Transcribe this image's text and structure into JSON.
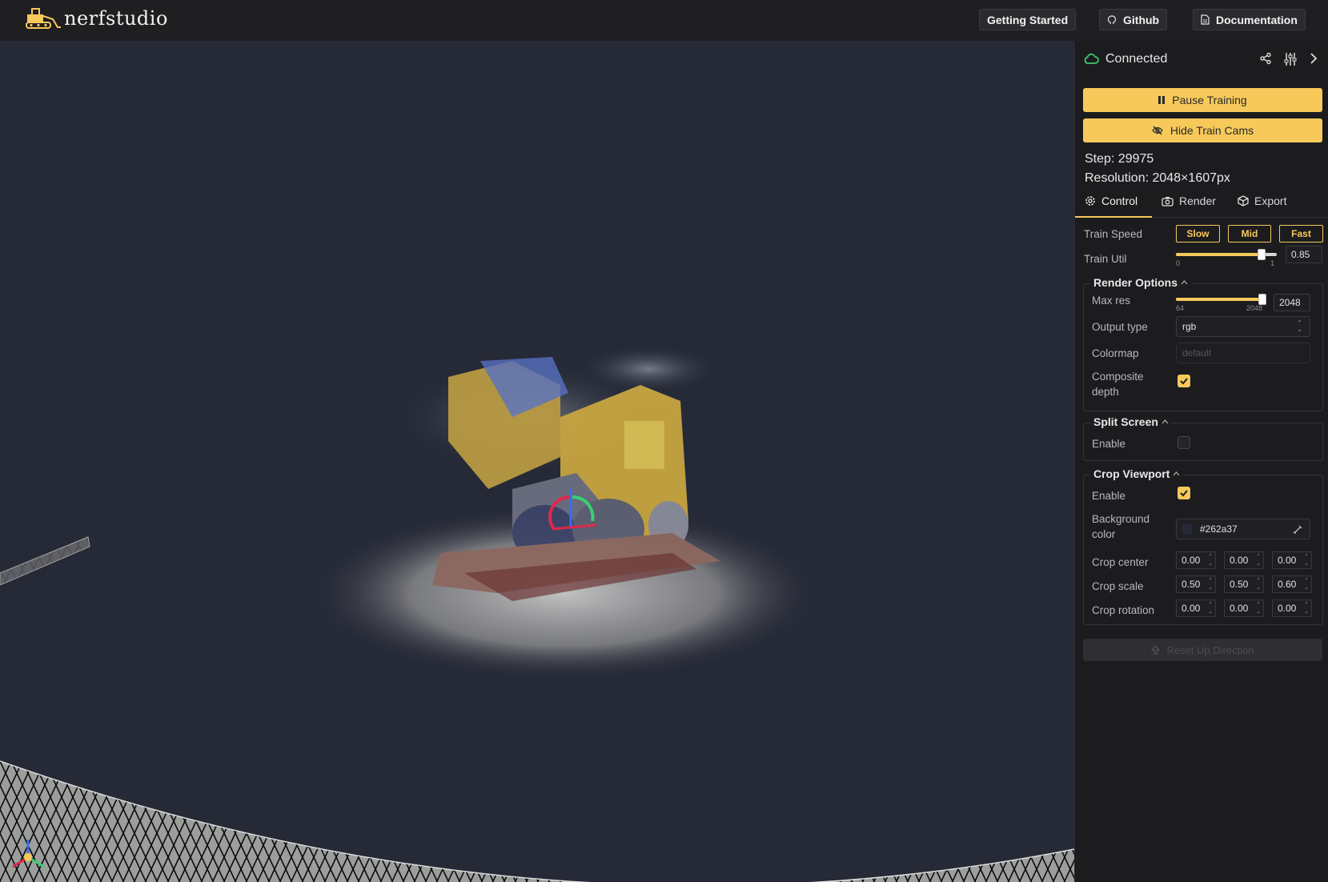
{
  "brand": {
    "name": "nerfstudio"
  },
  "header": {
    "getting_started": "Getting Started",
    "github": "Github",
    "documentation": "Documentation"
  },
  "panel": {
    "status": "Connected",
    "pause_training": "Pause Training",
    "hide_train_cams": "Hide Train Cams",
    "step": "Step: 29975",
    "resolution": "Resolution: 2048×1607px",
    "tabs": {
      "control": "Control",
      "render": "Render",
      "export": "Export"
    },
    "train_speed": {
      "label": "Train Speed",
      "slow": "Slow",
      "mid": "Mid",
      "fast": "Fast"
    },
    "train_util": {
      "label": "Train Util",
      "value": "0.85",
      "min": "0",
      "max": "1",
      "level": 0.85
    },
    "render_options": {
      "title": "Render Options",
      "max_res": {
        "label": "Max res",
        "value": "2048",
        "min": "64",
        "max": "2048",
        "level": 1.0
      },
      "output_type": {
        "label": "Output type",
        "value": "rgb"
      },
      "colormap": {
        "label": "Colormap",
        "placeholder": "default"
      },
      "composite_depth": {
        "label_line1": "Composite",
        "label_line2": "depth",
        "checked": true
      }
    },
    "split_screen": {
      "title": "Split Screen",
      "enable_label": "Enable",
      "checked": false
    },
    "crop_viewport": {
      "title": "Crop Viewport",
      "enable_label": "Enable",
      "checked": true,
      "background_label_line1": "Background",
      "background_label_line2": "color",
      "background_value": "#262a37",
      "crop_center": {
        "label": "Crop center",
        "values": [
          "0.00",
          "0.00",
          "0.00"
        ]
      },
      "crop_scale": {
        "label": "Crop scale",
        "values": [
          "0.50",
          "0.50",
          "0.60"
        ]
      },
      "crop_rotation": {
        "label": "Crop rotation",
        "values": [
          "0.00",
          "0.00",
          "0.00"
        ]
      }
    },
    "reset_up": "Reset Up Direction"
  },
  "colors": {
    "accent": "#f6c95a",
    "viewport_bg": "#262a37",
    "connected": "#3cc86e"
  }
}
